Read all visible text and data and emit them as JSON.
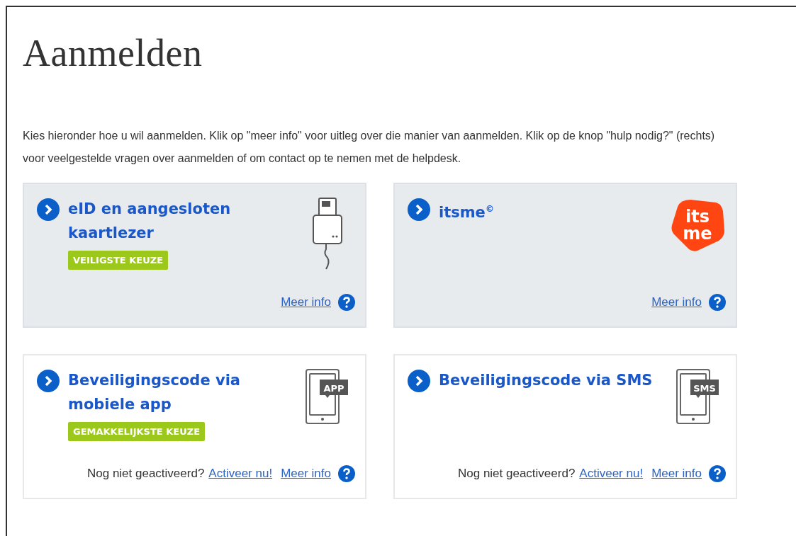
{
  "page": {
    "title": "Aanmelden",
    "intro": "Kies hieronder hoe u wil aanmelden. Klik op \"meer info\" voor uitleg over die manier van aanmelden. Klik op de knop \"hulp nodig?\" (rechts) voor veelgestelde vragen over aanmelden of om contact op te nemen met de helpdesk."
  },
  "options": [
    {
      "title": "eID en aangesloten kaartlezer",
      "highlighted": true,
      "badge": "VEILIGSTE KEUZE",
      "icon": {
        "kind": "card-reader"
      },
      "more_info": "Meer info"
    },
    {
      "title": "itsme$^{©}$",
      "highlighted": true,
      "icon": {
        "kind": "logo",
        "lines": [
          "its",
          "me"
        ]
      },
      "more_info": "Meer info"
    },
    {
      "title": "Beveiligingscode via mobiele app",
      "highlighted": false,
      "badge": "GEMAKKELIJKSTE KEUZE",
      "icon": {
        "kind": "phone",
        "label": "APP"
      },
      "activation": {
        "question": "Nog niet geactiveerd?",
        "link": "Activeer nu!"
      },
      "more_info": "Meer info"
    },
    {
      "title": "Beveiligingscode via SMS",
      "highlighted": false,
      "icon": {
        "kind": "phone",
        "label": "SMS"
      },
      "activation": {
        "question": "Nog niet geactiveerd?",
        "link": "Activeer nu!"
      },
      "more_info": "Meer info"
    }
  ]
}
